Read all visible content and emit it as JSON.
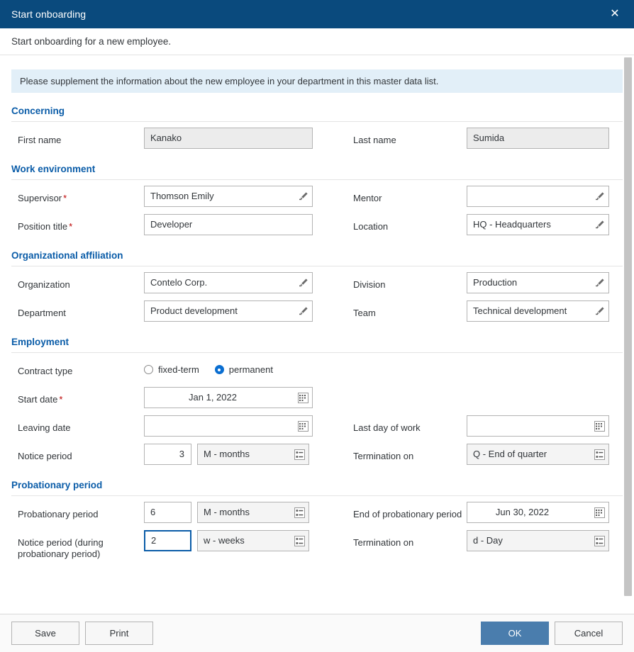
{
  "window": {
    "title": "Start onboarding",
    "close_icon": "close-icon",
    "subtitle": "Start onboarding for a new employee.",
    "message": "Please supplement the information about the new employee in your department in this master data list."
  },
  "colors": {
    "titlebar": "#0a4a7d",
    "section_heading": "#0a5ca8",
    "message_strip": "#e2eff8",
    "required_marker": "#b00000",
    "radio_selected": "#0a6ed1",
    "primary_button": "#4a7dad"
  },
  "sections": [
    {
      "title": "Concerning",
      "rows": [
        {
          "left": {
            "label": "First name",
            "required": false,
            "value": "Kanako",
            "kind": "readonly"
          },
          "right": {
            "label": "Last name",
            "required": false,
            "value": "Sumida",
            "kind": "readonly"
          }
        }
      ]
    },
    {
      "title": "Work environment",
      "rows": [
        {
          "left": {
            "label": "Supervisor",
            "required": true,
            "value": "Thomson Emily",
            "kind": "valuehelp",
            "icon": "value-help-pencil-icon"
          },
          "right": {
            "label": "Mentor",
            "required": false,
            "value": "",
            "kind": "valuehelp",
            "icon": "value-help-pencil-icon"
          }
        },
        {
          "left": {
            "label": "Position title",
            "required": true,
            "value": "Developer",
            "kind": "input"
          },
          "right": {
            "label": "Location",
            "required": false,
            "value": "HQ - Headquarters",
            "kind": "valuehelp",
            "icon": "value-help-pencil-icon"
          }
        }
      ]
    },
    {
      "title": "Organizational affiliation",
      "rows": [
        {
          "left": {
            "label": "Organization",
            "required": false,
            "value": "Contelo Corp.",
            "kind": "valuehelp",
            "icon": "value-help-pencil-icon"
          },
          "right": {
            "label": "Division",
            "required": false,
            "value": "Production",
            "kind": "valuehelp",
            "icon": "value-help-pencil-icon"
          }
        },
        {
          "left": {
            "label": "Department",
            "required": false,
            "value": "Product development",
            "kind": "valuehelp",
            "icon": "value-help-pencil-icon"
          },
          "right": {
            "label": "Team",
            "required": false,
            "value": "Technical development",
            "kind": "valuehelp",
            "icon": "value-help-pencil-icon"
          }
        }
      ]
    }
  ],
  "employment": {
    "title": "Employment",
    "contract_type": {
      "label": "Contract type",
      "options": [
        {
          "label": "fixed-term",
          "selected": false
        },
        {
          "label": "permanent",
          "selected": true
        }
      ]
    },
    "start_date": {
      "label": "Start date",
      "required": true,
      "value": "Jan 1, 2022",
      "icon": "calendar-icon"
    },
    "leaving_date": {
      "label": "Leaving date",
      "required": false,
      "value": "",
      "icon": "calendar-icon"
    },
    "last_day": {
      "label": "Last day of work",
      "required": false,
      "value": "",
      "icon": "calendar-icon"
    },
    "notice_period": {
      "label": "Notice period",
      "amount": "3",
      "unit": "M - months",
      "unit_icon": "list-select-icon"
    },
    "termination_on": {
      "label": "Termination on",
      "value": "Q - End of quarter",
      "icon": "list-select-icon"
    }
  },
  "probation": {
    "title": "Probationary period",
    "period": {
      "label": "Probationary period",
      "amount": "6",
      "unit": "M - months",
      "unit_icon": "list-select-icon"
    },
    "end_date": {
      "label": "End of probationary period",
      "value": "Jun 30, 2022",
      "icon": "calendar-icon"
    },
    "notice_period": {
      "label": "Notice period (during probationary period)",
      "amount": "2",
      "unit": "w - weeks",
      "unit_icon": "list-select-icon",
      "focused": true
    },
    "termination_on": {
      "label": "Termination on",
      "value": "d - Day",
      "icon": "list-select-icon"
    }
  },
  "footer": {
    "save": "Save",
    "print": "Print",
    "ok": "OK",
    "cancel": "Cancel"
  }
}
